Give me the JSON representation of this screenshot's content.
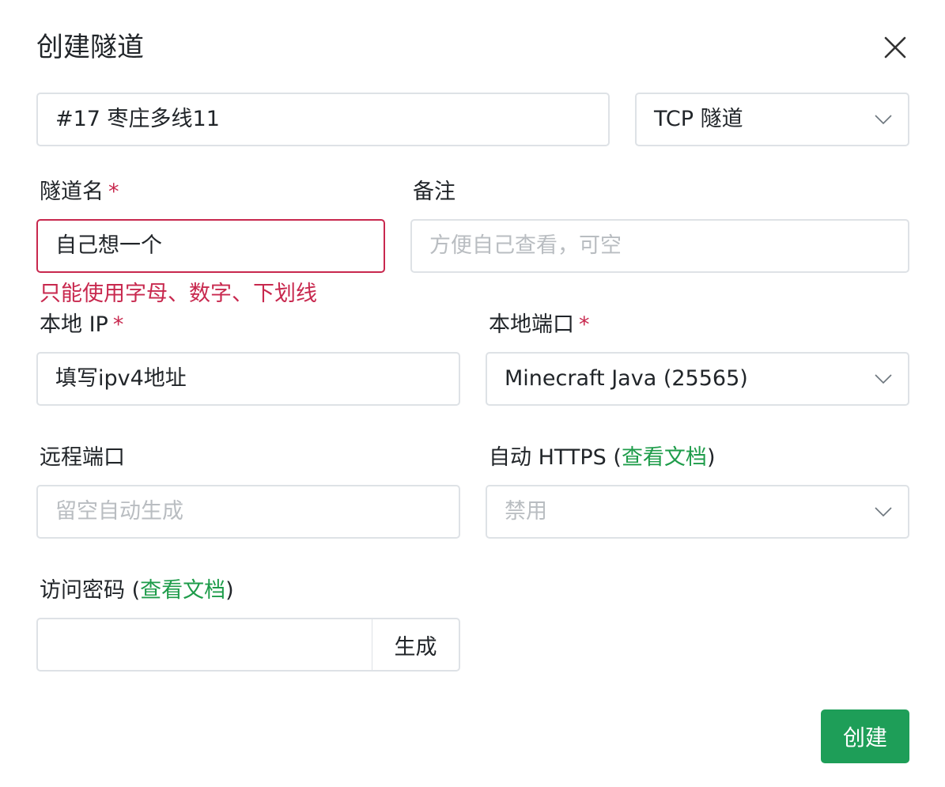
{
  "dialog": {
    "title": "创建隧道",
    "close_icon": "close-icon"
  },
  "node_select": {
    "value": "#17 枣庄多线11"
  },
  "type_select": {
    "value": "TCP 隧道"
  },
  "tunnel_name": {
    "label": "隧道名",
    "required_mark": "*",
    "value": "自己想一个",
    "error": "只能使用字母、数字、下划线"
  },
  "remark": {
    "label": "备注",
    "placeholder": "方便自己查看，可空"
  },
  "local_ip": {
    "label": "本地 IP",
    "required_mark": "*",
    "value": "填写ipv4地址"
  },
  "local_port": {
    "label": "本地端口",
    "required_mark": "*",
    "value": "Minecraft Java (25565)"
  },
  "remote_port": {
    "label": "远程端口",
    "placeholder": "留空自动生成"
  },
  "auto_https": {
    "label_prefix": "自动 HTTPS (",
    "doc_link": "查看文档",
    "label_suffix": ")",
    "value": "禁用"
  },
  "access_password": {
    "label_prefix": "访问密码 (",
    "doc_link": "查看文档",
    "label_suffix": ")",
    "value": "",
    "generate_label": "生成"
  },
  "submit_label": "创建",
  "colors": {
    "accent": "#1e9e58",
    "link": "#1e9c4a",
    "error": "#c8284e",
    "border": "#dee2e6",
    "placeholder": "#b9bdc1"
  }
}
